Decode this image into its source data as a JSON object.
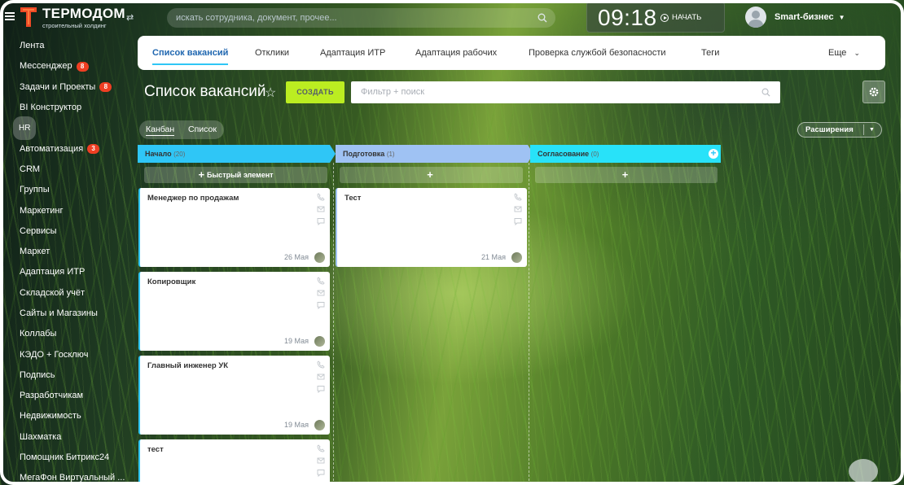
{
  "header": {
    "logo_title": "ТЕРМОДОМ",
    "logo_subtitle": "строительный холдинг",
    "search_placeholder": "искать сотрудника, документ, прочее...",
    "clock": "09:18",
    "start_label": "НАЧАТЬ",
    "user_name": "Smart-бизнес"
  },
  "sidebar": {
    "items": [
      {
        "label": "Лента"
      },
      {
        "label": "Мессенджер",
        "badge": "8"
      },
      {
        "label": "Задачи и Проекты",
        "badge": "8"
      },
      {
        "label": "BI Конструктор"
      },
      {
        "label": "HR"
      },
      {
        "label": "Автоматизация",
        "badge": "3"
      },
      {
        "label": "CRM"
      },
      {
        "label": "Группы"
      },
      {
        "label": "Маркетинг"
      },
      {
        "label": "Сервисы"
      },
      {
        "label": "Маркет"
      },
      {
        "label": "Адаптация ИТР"
      },
      {
        "label": "Складской учёт"
      },
      {
        "label": "Сайты и Магазины"
      },
      {
        "label": "Коллабы"
      },
      {
        "label": "КЭДО + Госключ"
      },
      {
        "label": "Подпись"
      },
      {
        "label": "Разработчикам"
      },
      {
        "label": "Недвижимость"
      },
      {
        "label": "Шахматка"
      },
      {
        "label": "Помощник Битрикс24"
      },
      {
        "label": "МегаФон Виртуальный ..."
      }
    ]
  },
  "tabs": {
    "items": [
      {
        "label": "Список вакансий"
      },
      {
        "label": "Отклики"
      },
      {
        "label": "Адаптация ИТР"
      },
      {
        "label": "Адаптация рабочих"
      },
      {
        "label": "Проверка службой безопасности"
      },
      {
        "label": "Теги"
      }
    ],
    "more_label": "Еще"
  },
  "page": {
    "title": "Список вакансий",
    "create_label": "СОЗДАТЬ",
    "filter_placeholder": "Фильтр + поиск",
    "view_kanban": "Канбан",
    "view_list": "Список",
    "extensions_label": "Расширения"
  },
  "kanban": {
    "quick_add_label": "Быстрый элемент",
    "columns": [
      {
        "title": "Начало",
        "count": "(20)",
        "color": "#2fc6f6"
      },
      {
        "title": "Подготовка",
        "count": "(1)",
        "color": "#9fc2f3"
      },
      {
        "title": "Согласование",
        "count": "(0)",
        "color": "#28e2f9"
      }
    ],
    "cards": [
      {
        "title": "Менеджер по продажам",
        "date": "26 Мая"
      },
      {
        "title": "Копировщик",
        "date": "19 Мая"
      },
      {
        "title": "Главный инженер УК",
        "date": "19 Мая"
      },
      {
        "title": "тест",
        "date": ""
      },
      {
        "title": "Тест",
        "date": "21 Мая"
      }
    ]
  }
}
